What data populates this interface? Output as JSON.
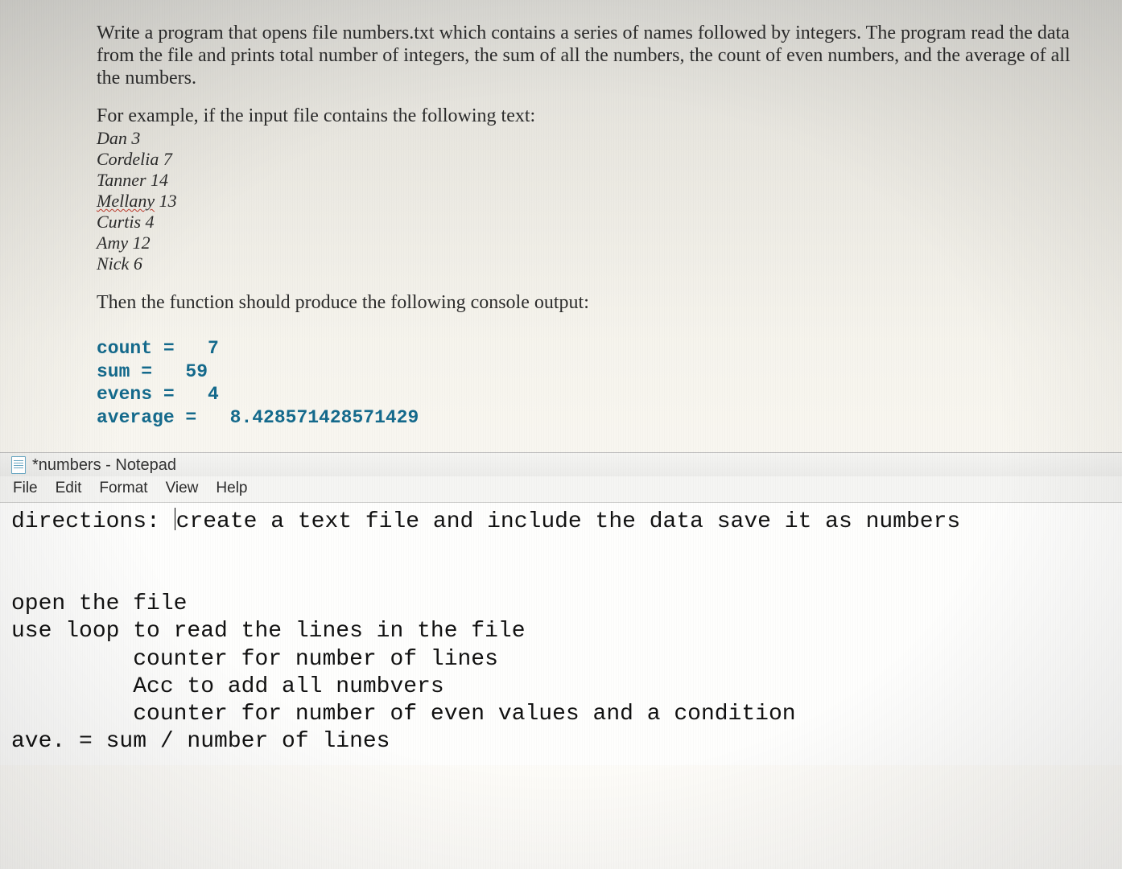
{
  "problem": {
    "paragraph1": "Write a program that opens file numbers.txt which contains a series of names followed by integers. The program read the data from the file and prints total number of integers, the sum of all the numbers, the count of even numbers, and the average of all the numbers.",
    "example_intro": "For example, if the input file contains the following text:",
    "input_lines": [
      {
        "name": "Dan",
        "num": "3"
      },
      {
        "name": "Cordelia",
        "num": "7"
      },
      {
        "name": "Tanner",
        "num": "14"
      },
      {
        "name": "Mellany",
        "num": "13",
        "wavy": true
      },
      {
        "name": "Curtis",
        "num": "4"
      },
      {
        "name": "Amy",
        "num": "12"
      },
      {
        "name": "Nick",
        "num": "6"
      }
    ],
    "then_line": "Then the function should produce the following console output:",
    "console": {
      "count_label": "count = ",
      "count_value": "  7",
      "sum_label": "sum = ",
      "sum_value": "  59",
      "evens_label": "evens = ",
      "evens_value": "  4",
      "average_label": "average = ",
      "average_value": "  8.428571428571429"
    }
  },
  "notepad": {
    "title": "*numbers - Notepad",
    "menu": [
      "File",
      "Edit",
      "Format",
      "View",
      "Help"
    ],
    "lines": [
      "directions: create a text file and include the data save it as numbers",
      "",
      "",
      "open the file",
      "use loop to read the lines in the file",
      "         counter for number of lines",
      "         Acc to add all numbvers",
      "         counter for number of even values and a condition",
      "ave. = sum / number of lines"
    ],
    "cursor_line": 0,
    "cursor_col": 12
  }
}
